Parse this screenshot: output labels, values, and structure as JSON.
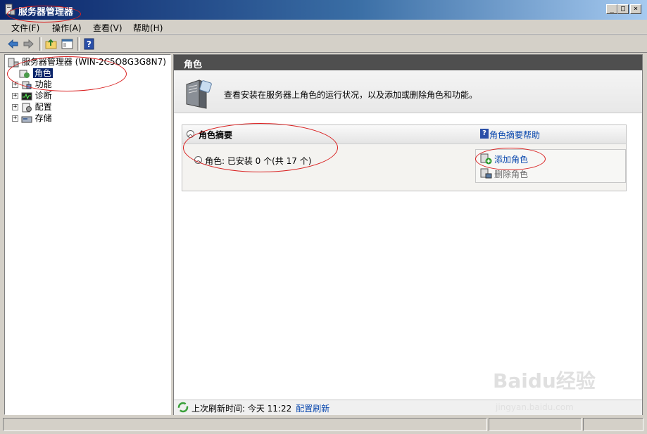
{
  "window": {
    "title": "服务器管理器",
    "controls": {
      "minimize": "_",
      "maximize": "□",
      "close": "×"
    }
  },
  "menu": {
    "items": [
      "文件(F)",
      "操作(A)",
      "查看(V)",
      "帮助(H)"
    ]
  },
  "tree": {
    "root": "服务器管理器 (WIN-2C5O8G3G8N7)",
    "items": [
      {
        "label": "角色",
        "selected": true
      },
      {
        "label": "功能"
      },
      {
        "label": "诊断"
      },
      {
        "label": "配置"
      },
      {
        "label": "存储"
      }
    ],
    "expander": "+"
  },
  "main": {
    "header": "角色",
    "intro": "查看安装在服务器上角色的运行状况，以及添加或删除角色和功能。",
    "summary": {
      "title": "角色摘要",
      "help": "角色摘要帮助",
      "roles_status": "角色: 已安装 0 个(共 17 个)",
      "add_role": "添加角色",
      "remove_role": "删除角色"
    },
    "refresh": {
      "text": "上次刷新时间: 今天 11:22",
      "link": "配置刷新"
    }
  },
  "watermark": {
    "brand": "Baidu经验",
    "url": "jingyan.baidu.com"
  },
  "colors": {
    "titlebar": "#0a246a",
    "link": "#0645ad",
    "annotation": "#d92020"
  }
}
